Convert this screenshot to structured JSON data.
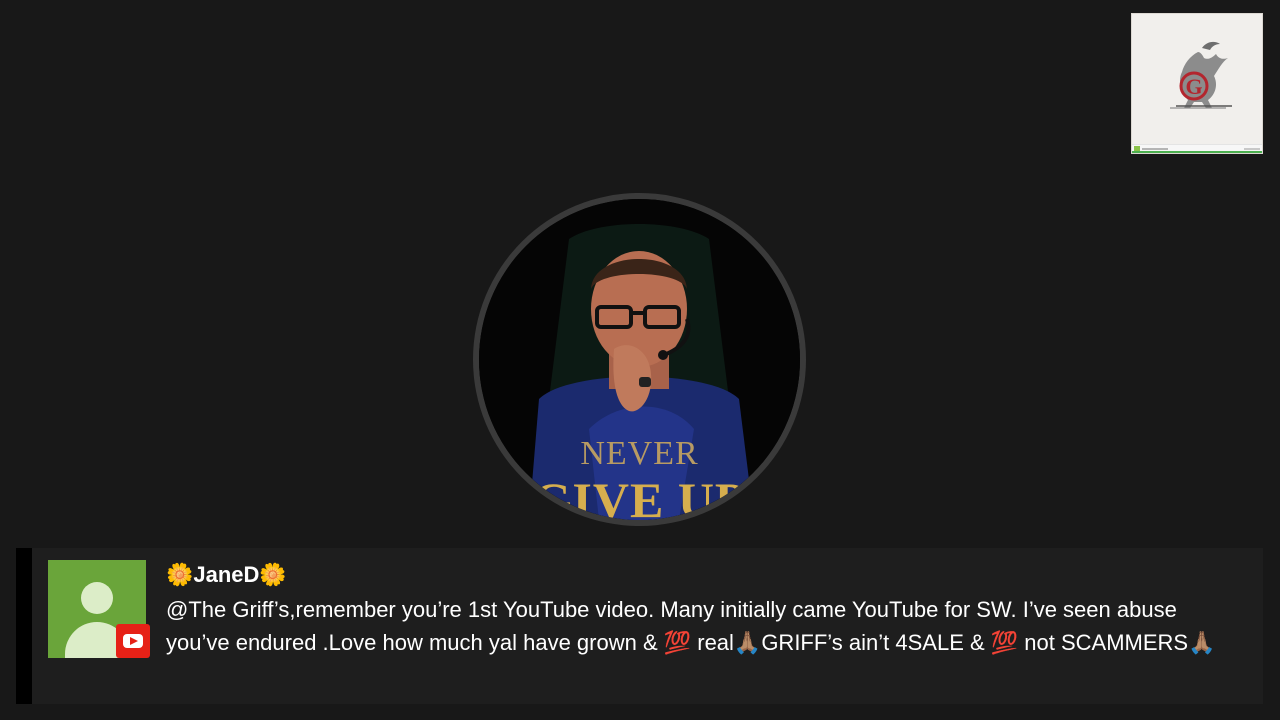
{
  "logo": {
    "letter": "G",
    "icon": "griffin-logo-icon"
  },
  "profile": {
    "icon": "profile-photo",
    "motto_line1": "NEVER",
    "motto_line2": "GIVE UP"
  },
  "chat": {
    "author": "🌼JaneD🌼",
    "message": "@The Griff’s,remember you’re 1st YouTube video. Many initially came YouTube for SW. I’ve seen abuse you’ve endured .Love how much yal have grown & 💯 real🙏🏽GRIFF’s ain’t 4SALE & 💯 not SCAMMERS🙏🏽",
    "platform_icon": "youtube-icon",
    "avatar_icon": "default-user-avatar-icon"
  },
  "colors": {
    "background": "#181818",
    "chat_panel": "#1e1e1e",
    "avatar_green": "#6aa53a",
    "youtube_red": "#e62117",
    "motto_gold": "#d6ae4e"
  }
}
